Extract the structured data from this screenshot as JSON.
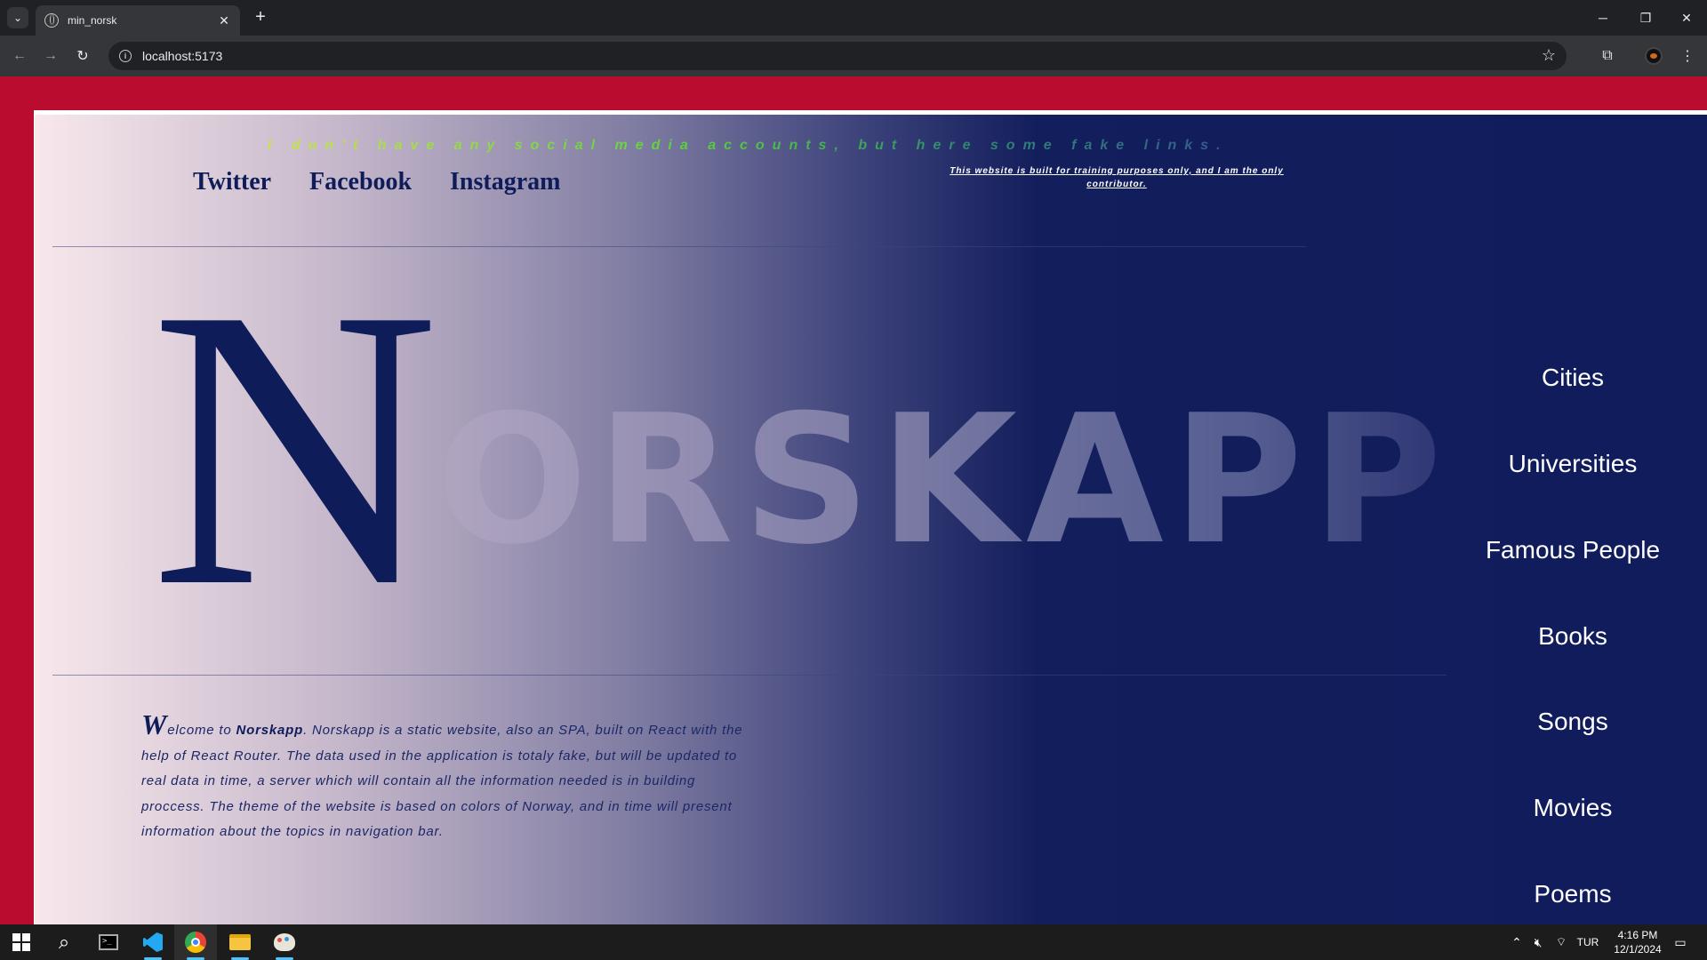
{
  "browser": {
    "tab_title": "min_norsk",
    "url": "localhost:5173",
    "tab_close": "✕",
    "new_tab": "+"
  },
  "site": {
    "tagline": "I don't have any social media accounts, but here some fake links.",
    "social_links": [
      "Twitter",
      "Facebook",
      "Instagram"
    ],
    "disclaimer": "This website is built for training purposes only, and I am the only contributor.",
    "logo": {
      "initial": "N",
      "rest": "ORSKAPP"
    },
    "intro": {
      "dropcap": "W",
      "lead": "elcome to ",
      "brand": "Norskapp",
      "body": ". Norskapp is a static website, also an SPA, built on React with the help of React Router. The data used in the application is totaly fake, but will be updated to real data in time, a server which will contain all the information needed is in building proccess. The theme of the website is based on colors of Norway, and in time will present information about the topics in navigation bar."
    },
    "nav": [
      "Cities",
      "Universities",
      "Famous People",
      "Books",
      "Songs",
      "Movies",
      "Poems"
    ]
  },
  "taskbar": {
    "language": "TUR",
    "time": "4:16 PM",
    "date": "12/1/2024"
  },
  "colors": {
    "flag_red": "#ba0c2f",
    "flag_blue": "#101c5c",
    "white": "#ffffff"
  }
}
